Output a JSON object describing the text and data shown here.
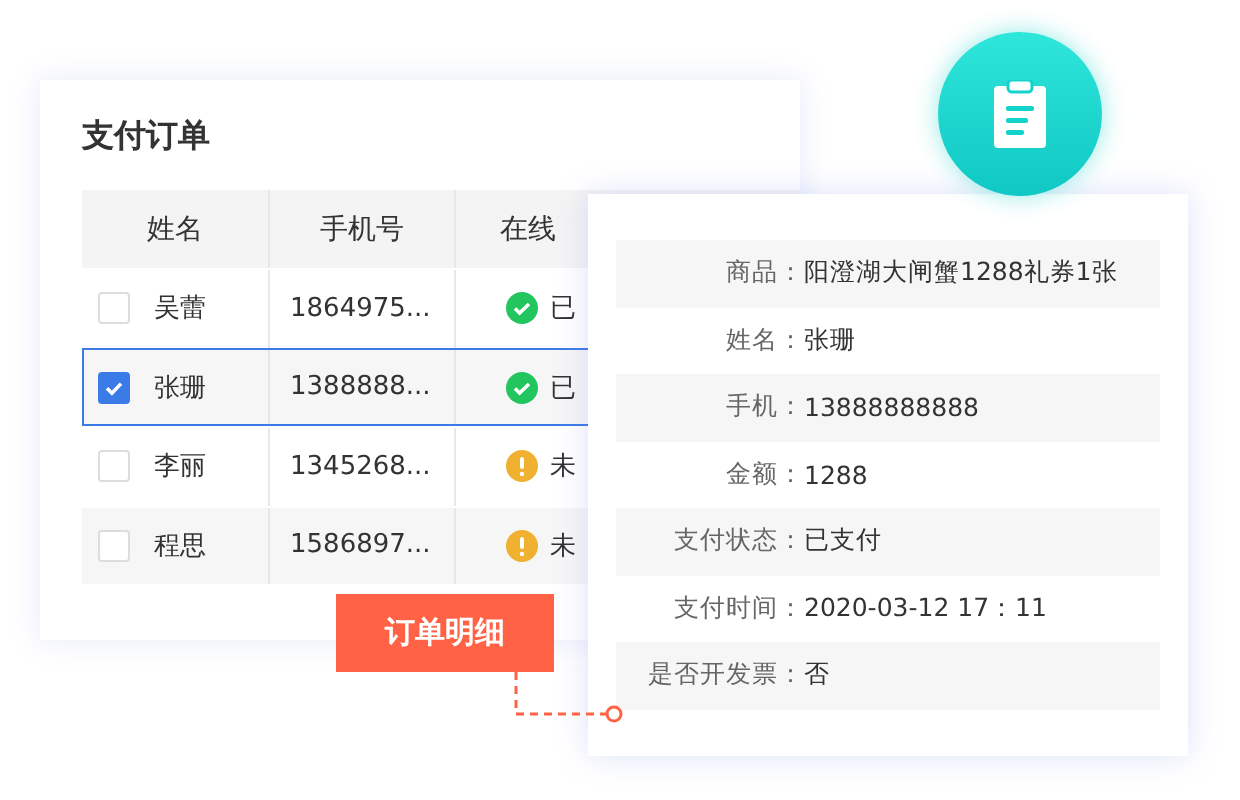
{
  "title": "支付订单",
  "table": {
    "columns": [
      "姓名",
      "手机号",
      "在线"
    ],
    "rows": [
      {
        "name": "吴蕾",
        "phone": "1864975...",
        "checked": false,
        "selected": false,
        "status": {
          "kind": "paid",
          "text": "已"
        }
      },
      {
        "name": "张珊",
        "phone": "1388888...",
        "checked": true,
        "selected": true,
        "status": {
          "kind": "paid",
          "text": "已"
        }
      },
      {
        "name": "李丽",
        "phone": "1345268...",
        "checked": false,
        "selected": false,
        "status": {
          "kind": "unpaid",
          "text": "未"
        }
      },
      {
        "name": "程思",
        "phone": "1586897...",
        "checked": false,
        "selected": false,
        "status": {
          "kind": "unpaid",
          "text": "未"
        }
      }
    ]
  },
  "detail": {
    "rows": [
      {
        "label": "商品：",
        "value": "阳澄湖大闸蟹1288礼券1张"
      },
      {
        "label": "姓名：",
        "value": "张珊"
      },
      {
        "label": "手机：",
        "value": "13888888888"
      },
      {
        "label": "金额：",
        "value": "1288"
      },
      {
        "label": "支付状态：",
        "value": "已支付"
      },
      {
        "label": "支付时间：",
        "value": "2020-03-12 17：11"
      },
      {
        "label": "是否开发票：",
        "value": "否"
      }
    ]
  },
  "button": "订单明细"
}
